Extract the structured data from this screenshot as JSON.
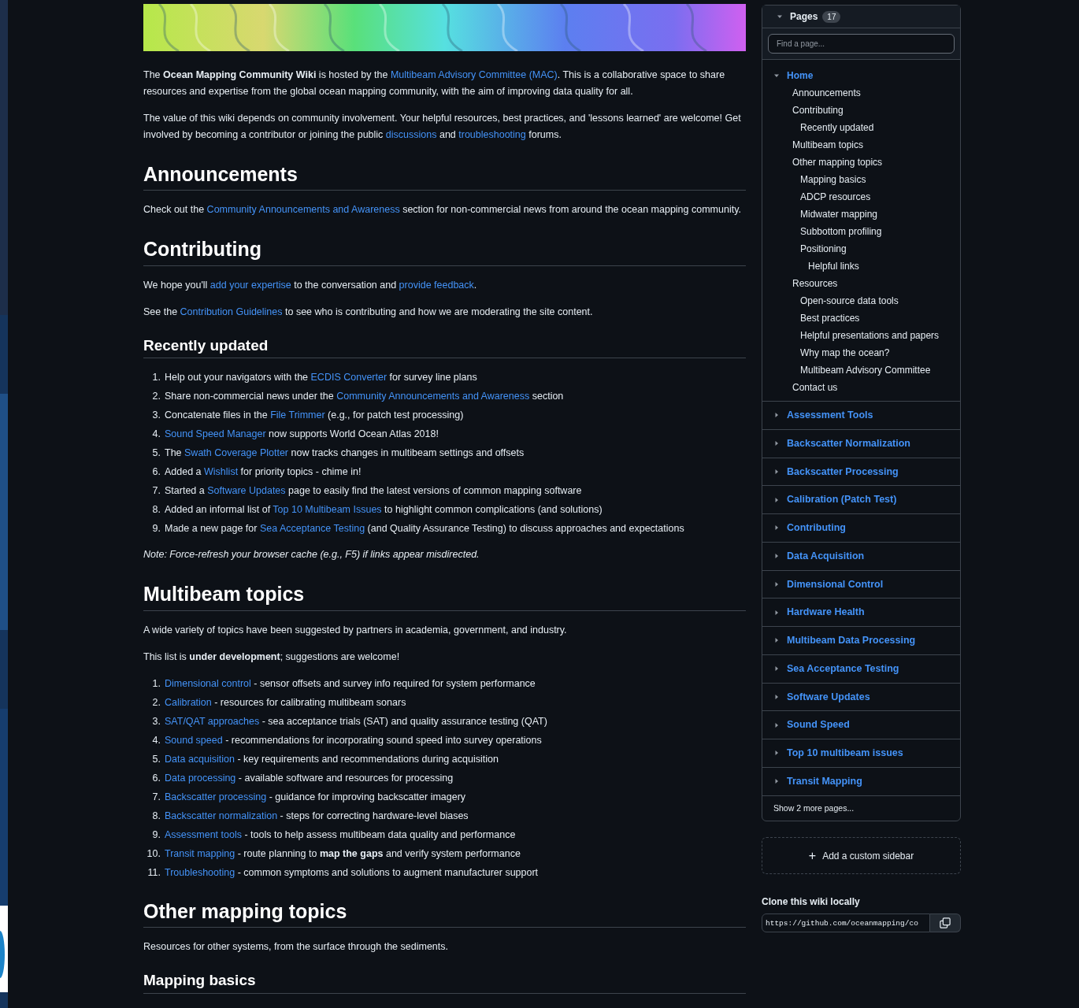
{
  "content": [
    {
      "kind": "paragraph",
      "parts": [
        {
          "kind": "text",
          "text": "The **Ocean Mapping Community Wiki** is hosted by the "
        },
        {
          "kind": "link",
          "text": "Multibeam Advisory Committee (MAC)"
        },
        {
          "kind": "text",
          "text": ". This is a collaborative space to share resources and expertise from the global ocean mapping community, with the aim of improving data quality for all."
        }
      ]
    },
    {
      "kind": "paragraph",
      "parts": [
        {
          "kind": "text",
          "text": "The value of this wiki depends on community involvement. Your helpful resources, best practices, and 'lessons learned' are welcome! Get involved by becoming a contributor or joining the public "
        },
        {
          "kind": "link",
          "text": "discussions"
        },
        {
          "kind": "text",
          "text": " and "
        },
        {
          "kind": "link",
          "text": "troubleshooting"
        },
        {
          "kind": "text",
          "text": " forums."
        }
      ]
    },
    {
      "kind": "title",
      "text": "Announcements"
    },
    {
      "kind": "paragraph",
      "parts": [
        {
          "kind": "text",
          "text": "Check out the "
        },
        {
          "kind": "link",
          "text": "Community Announcements and Awareness"
        },
        {
          "kind": "text",
          "text": " section for non-commercial news from around the ocean mapping community."
        }
      ]
    },
    {
      "kind": "title",
      "text": "Contributing"
    },
    {
      "kind": "paragraph",
      "parts": [
        {
          "kind": "text",
          "text": "We hope you'll "
        },
        {
          "kind": "link",
          "text": "add your expertise"
        },
        {
          "kind": "text",
          "text": " to the conversation and "
        },
        {
          "kind": "link",
          "text": "provide feedback"
        },
        {
          "kind": "text",
          "text": "."
        }
      ]
    },
    {
      "kind": "paragraph",
      "parts": [
        {
          "kind": "text",
          "text": "See the "
        },
        {
          "kind": "link",
          "text": "Contribution Guidelines"
        },
        {
          "kind": "text",
          "text": " to see who is contributing and how we are moderating the site content."
        }
      ]
    },
    {
      "kind": "subtitle",
      "text": "Recently updated"
    },
    {
      "kind": "list",
      "items": [
        {
          "number": "1.",
          "parts": [
            {
              "kind": "text",
              "text": "Help out your navigators with the "
            },
            {
              "kind": "link",
              "text": "ECDIS Converter"
            },
            {
              "kind": "text",
              "text": " for survey line plans"
            }
          ]
        },
        {
          "number": "2.",
          "parts": [
            {
              "kind": "text",
              "text": "Share non-commercial news under the "
            },
            {
              "kind": "link",
              "text": "Community Announcements and Awareness"
            },
            {
              "kind": "text",
              "text": " section"
            }
          ]
        },
        {
          "number": "3.",
          "parts": [
            {
              "kind": "text",
              "text": "Concatenate files in the "
            },
            {
              "kind": "link",
              "text": "File Trimmer"
            },
            {
              "kind": "text",
              "text": " (e.g., for patch test processing)"
            }
          ]
        },
        {
          "number": "4.",
          "parts": [
            {
              "kind": "link",
              "text": "Sound Speed Manager"
            },
            {
              "kind": "text",
              "text": " now supports World Ocean Atlas 2018!"
            }
          ]
        },
        {
          "number": "5.",
          "parts": [
            {
              "kind": "text",
              "text": "The "
            },
            {
              "kind": "link",
              "text": "Swath Coverage Plotter"
            },
            {
              "kind": "text",
              "text": " now tracks changes in multibeam settings and offsets"
            }
          ]
        },
        {
          "number": "6.",
          "parts": [
            {
              "kind": "text",
              "text": "Added a "
            },
            {
              "kind": "link",
              "text": "Wishlist"
            },
            {
              "kind": "text",
              "text": " for priority topics - chime in!"
            }
          ]
        },
        {
          "number": "7.",
          "parts": [
            {
              "kind": "text",
              "text": "Started a "
            },
            {
              "kind": "link",
              "text": "Software Updates"
            },
            {
              "kind": "text",
              "text": " page to easily find the latest versions of common mapping software"
            }
          ]
        },
        {
          "number": "8.",
          "parts": [
            {
              "kind": "text",
              "text": "Added an informal list of "
            },
            {
              "kind": "link",
              "text": "Top 10 Multibeam Issues"
            },
            {
              "kind": "text",
              "text": " to highlight common complications (and solutions)"
            }
          ]
        },
        {
          "number": "9.",
          "parts": [
            {
              "kind": "text",
              "text": "Made a new page for "
            },
            {
              "kind": "link",
              "text": "Sea Acceptance Testing"
            },
            {
              "kind": "text",
              "text": " (and Quality Assurance Testing) to discuss approaches and expectations"
            }
          ]
        }
      ]
    },
    {
      "kind": "note",
      "parts": [
        {
          "kind": "text",
          "text": "Note: Force-refresh your browser cache (e.g., F5) if links appear misdirected."
        }
      ]
    },
    {
      "kind": "title",
      "text": "Multibeam topics"
    },
    {
      "kind": "paragraph",
      "parts": [
        {
          "kind": "text",
          "text": "A wide variety of topics have been suggested by partners in academia, government, and industry."
        }
      ]
    },
    {
      "kind": "paragraph",
      "parts": [
        {
          "kind": "text",
          "text": "This list is **under development**; suggestions are welcome!"
        }
      ]
    },
    {
      "kind": "list",
      "items": [
        {
          "number": "1.",
          "parts": [
            {
              "kind": "link",
              "text": "Dimensional control"
            },
            {
              "kind": "text",
              "text": " - sensor offsets and survey info required for system performance"
            }
          ]
        },
        {
          "number": "2.",
          "parts": [
            {
              "kind": "link",
              "text": "Calibration"
            },
            {
              "kind": "text",
              "text": " - resources for calibrating multibeam sonars"
            }
          ]
        },
        {
          "number": "3.",
          "parts": [
            {
              "kind": "link",
              "text": "SAT/QAT approaches"
            },
            {
              "kind": "text",
              "text": " - sea acceptance trials (SAT) and quality assurance testing (QAT)"
            }
          ]
        },
        {
          "number": "4.",
          "parts": [
            {
              "kind": "link",
              "text": "Sound speed"
            },
            {
              "kind": "text",
              "text": " - recommendations for incorporating sound speed into survey operations"
            }
          ]
        },
        {
          "number": "5.",
          "parts": [
            {
              "kind": "link",
              "text": "Data acquisition"
            },
            {
              "kind": "text",
              "text": " - key requirements and recommendations during acquisition"
            }
          ]
        },
        {
          "number": "6.",
          "parts": [
            {
              "kind": "link",
              "text": "Data processing"
            },
            {
              "kind": "text",
              "text": " - available software and resources for processing"
            }
          ]
        },
        {
          "number": "7.",
          "parts": [
            {
              "kind": "link",
              "text": "Backscatter processing"
            },
            {
              "kind": "text",
              "text": " - guidance for improving backscatter imagery"
            }
          ]
        },
        {
          "number": "8.",
          "parts": [
            {
              "kind": "link",
              "text": "Backscatter normalization"
            },
            {
              "kind": "text",
              "text": " - steps for correcting hardware-level biases"
            }
          ]
        },
        {
          "number": "9.",
          "parts": [
            {
              "kind": "link",
              "text": "Assessment tools"
            },
            {
              "kind": "text",
              "text": " - tools to help assess multibeam data quality and performance"
            }
          ]
        },
        {
          "number": "10.",
          "parts": [
            {
              "kind": "link",
              "text": "Transit mapping"
            },
            {
              "kind": "text",
              "text": " - route planning to **map the gaps** and verify system performance"
            }
          ]
        },
        {
          "number": "11.",
          "parts": [
            {
              "kind": "link",
              "text": "Troubleshooting"
            },
            {
              "kind": "text",
              "text": " - common symptoms and solutions to augment manufacturer support"
            }
          ]
        }
      ]
    },
    {
      "kind": "title",
      "text": "Other mapping topics"
    },
    {
      "kind": "paragraph",
      "parts": [
        {
          "kind": "text",
          "text": "Resources for other systems, from the surface through the sediments."
        }
      ]
    },
    {
      "kind": "subtitle",
      "text": "Mapping basics"
    }
  ],
  "sidebar": {
    "title": "Pages",
    "count": "17",
    "expanded": true,
    "search": {
      "placeholder": "Find a page..."
    },
    "pages": [
      {
        "title": "Home",
        "expanded": true,
        "children": [
          {
            "title": "Announcements"
          },
          {
            "title": "Contributing",
            "children": [
              {
                "title": "Recently updated"
              }
            ]
          },
          {
            "title": "Multibeam topics"
          },
          {
            "title": "Other mapping topics",
            "children": [
              {
                "title": "Mapping basics"
              },
              {
                "title": "ADCP resources"
              },
              {
                "title": "Midwater mapping"
              },
              {
                "title": "Subbottom profiling"
              },
              {
                "title": "Positioning",
                "children": [
                  {
                    "title": "Helpful links"
                  }
                ]
              }
            ]
          },
          {
            "title": "Resources",
            "children": [
              {
                "title": "Open-source data tools"
              },
              {
                "title": "Best practices"
              },
              {
                "title": "Helpful presentations and papers"
              },
              {
                "title": "Why map the ocean?"
              },
              {
                "title": "Multibeam Advisory Committee"
              }
            ]
          },
          {
            "title": "Contact us"
          }
        ]
      },
      {
        "title": "Assessment Tools",
        "expanded": false
      },
      {
        "title": "Backscatter Normalization",
        "expanded": false
      },
      {
        "title": "Backscatter Processing",
        "expanded": false
      },
      {
        "title": "Calibration (Patch Test)",
        "expanded": false
      },
      {
        "title": "Contributing",
        "expanded": false
      },
      {
        "title": "Data Acquisition",
        "expanded": false
      },
      {
        "title": "Dimensional Control",
        "expanded": false
      },
      {
        "title": "Hardware Health",
        "expanded": false
      },
      {
        "title": "Multibeam Data Processing",
        "expanded": false
      },
      {
        "title": "Sea Acceptance Testing",
        "expanded": false
      },
      {
        "title": "Software Updates",
        "expanded": false
      },
      {
        "title": "Sound Speed",
        "expanded": false
      },
      {
        "title": "Top 10 multibeam issues",
        "expanded": false
      },
      {
        "title": "Transit Mapping",
        "expanded": false
      }
    ],
    "more": "Show 2 more pages...",
    "add_button": {
      "icon": "+",
      "label": "Add a custom sidebar"
    },
    "clone": {
      "label": "Clone this wiki locally",
      "url": "https://github.com/oceanmapping/co"
    }
  }
}
